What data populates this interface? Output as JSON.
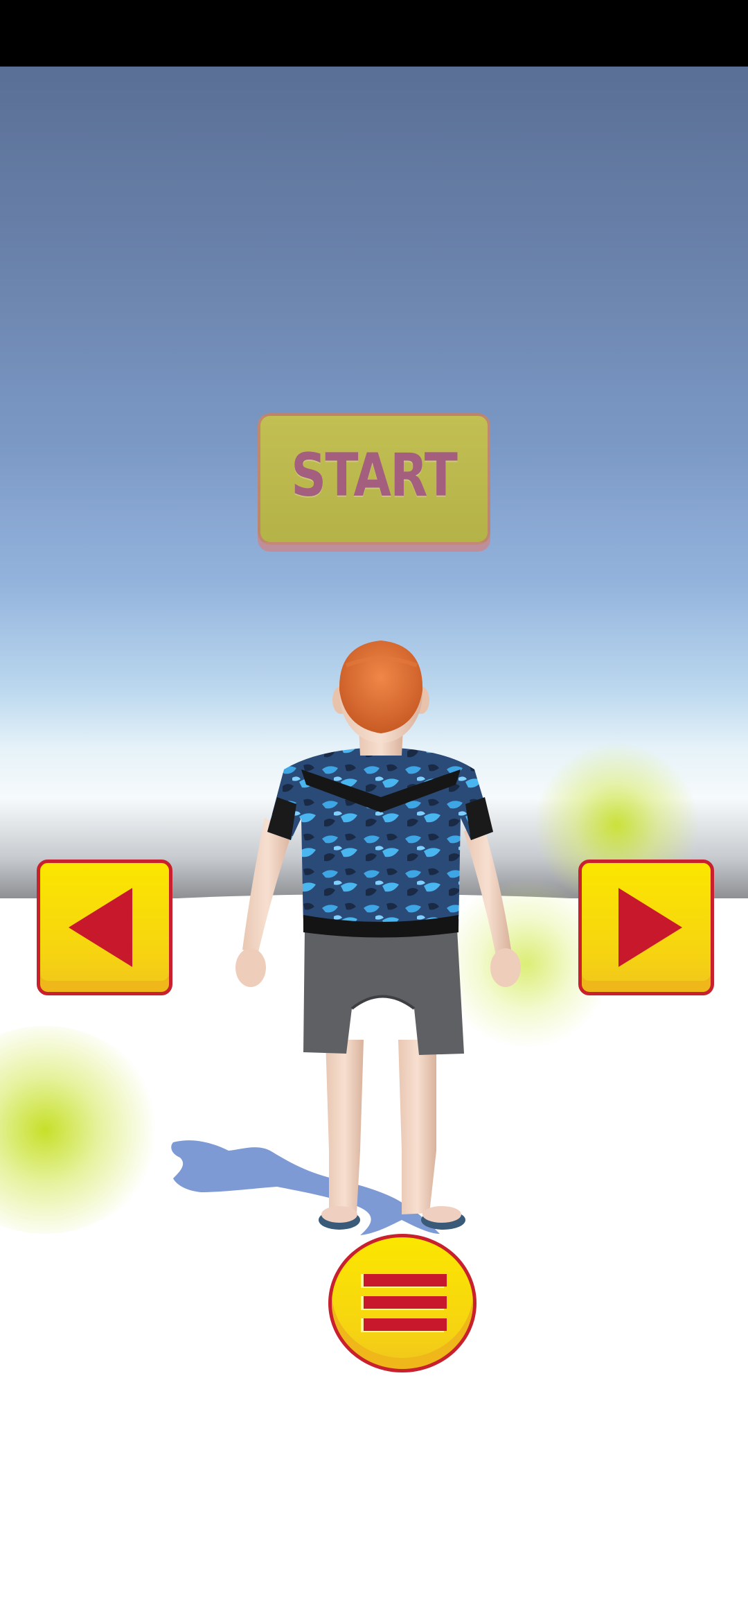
{
  "game": {
    "start_label": "START",
    "colors": {
      "button_yellow": "#f6d411",
      "button_border_red": "#c8202c",
      "arrow_red": "#c8182c",
      "start_fill": "#c9c34a",
      "start_text": "#a85a78"
    }
  },
  "controls": {
    "left_icon": "triangle-left-icon",
    "right_icon": "triangle-right-icon",
    "menu_icon": "hamburger-menu-icon"
  },
  "character": {
    "icon": "boy-player-character"
  }
}
